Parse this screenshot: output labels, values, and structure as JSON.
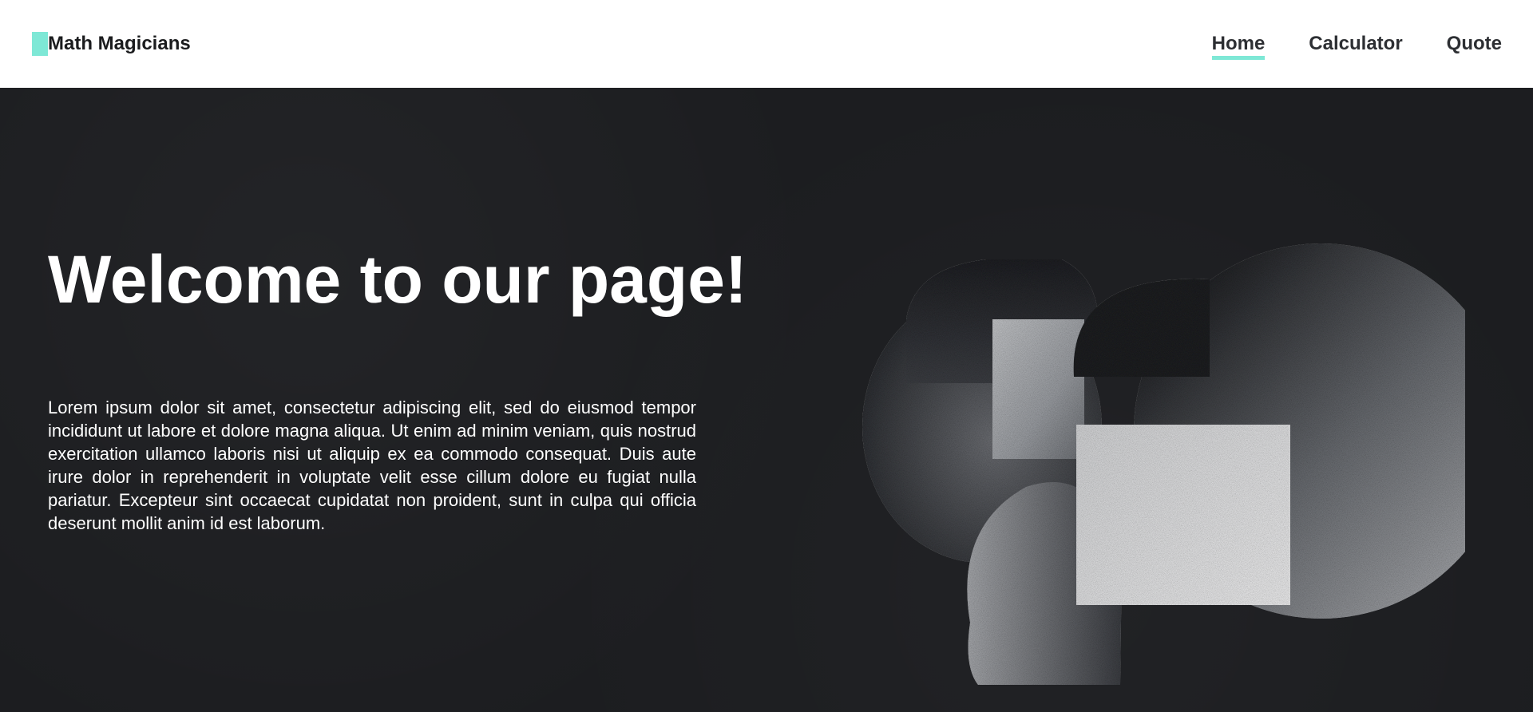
{
  "brand": {
    "name": "Math Magicians",
    "accent": "#7ee8d6"
  },
  "nav": {
    "items": [
      {
        "label": "Home",
        "active": true
      },
      {
        "label": "Calculator",
        "active": false
      },
      {
        "label": "Quote",
        "active": false
      }
    ]
  },
  "hero": {
    "title": "Welcome to our page!",
    "body": "Lorem ipsum dolor sit amet, consectetur adipiscing elit, sed do eiusmod tempor incididunt ut labore et dolore magna aliqua. Ut enim ad minim veniam, quis nostrud exercitation ullamco laboris nisi ut aliquip ex ea commodo consequat. Duis aute irure dolor in reprehenderit in voluptate velit esse cillum dolore eu fugiat nulla pariatur. Excepteur sint occaecat cupidatat non proident, sunt in culpa qui officia deserunt mollit anim id est laborum.",
    "background_color": "#1c1d20"
  }
}
